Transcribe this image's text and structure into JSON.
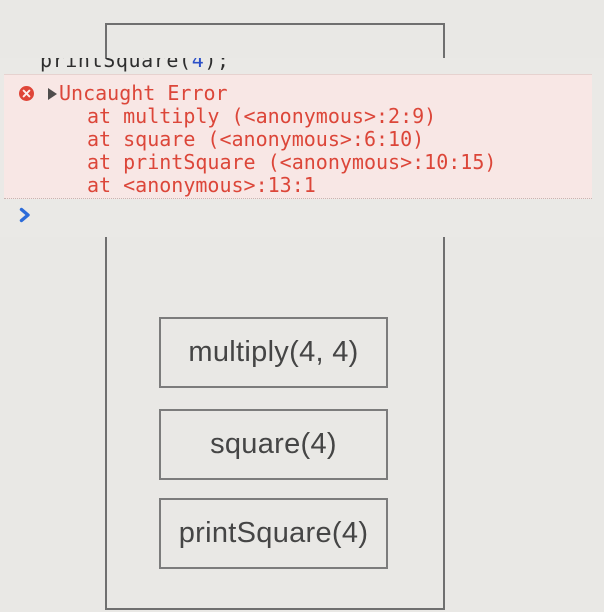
{
  "slide": {
    "background_color": "#e9e8e5",
    "outline_color": "#6f6f6f"
  },
  "console": {
    "echoed_code": {
      "function_part": "printSquare(",
      "number_arg": "4",
      "closing_part": ");"
    },
    "error": {
      "icon": "error-circle-x",
      "expander_icon": "triangle-right",
      "title": "Uncaught Error",
      "stack_lines": [
        "at multiply (<anonymous>:2:9)",
        "at square (<anonymous>:6:10)",
        "at printSquare (<anonymous>:10:15)",
        "at <anonymous>:13:1"
      ],
      "text_color": "#dc4639",
      "background_color": "#f8e7e5"
    },
    "prompt": {
      "icon": "chevron-right",
      "color": "#2c6bd9"
    }
  },
  "diagram": {
    "stack_frames": [
      "multiply(4, 4)",
      "square(4)",
      "printSquare(4)"
    ]
  }
}
